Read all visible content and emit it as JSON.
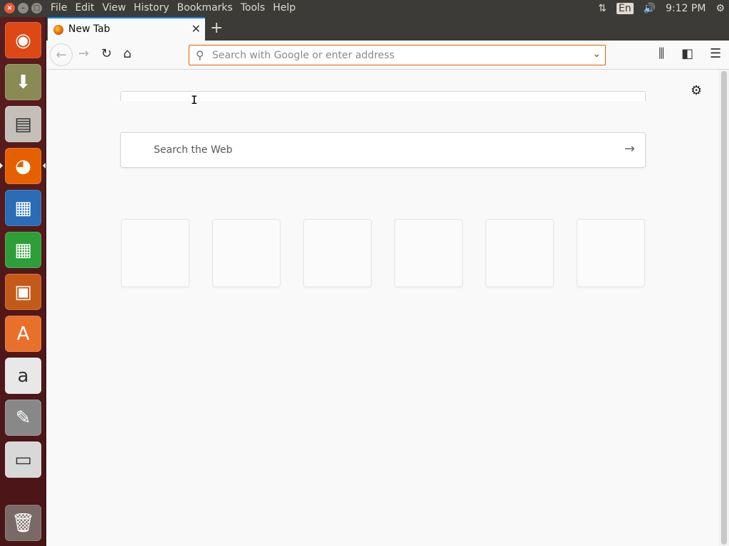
{
  "top_panel": {
    "menus": [
      "File",
      "Edit",
      "View",
      "History",
      "Bookmarks",
      "Tools",
      "Help"
    ],
    "language": "En",
    "clock": "9:12 PM",
    "icons": [
      "network-icon",
      "volume-icon",
      "system-gear-icon"
    ]
  },
  "launcher": {
    "items": [
      {
        "name": "ubuntu-dash-icon",
        "symbol": "◉",
        "bg": "#dd4814"
      },
      {
        "name": "software-updater-icon",
        "symbol": "⬇",
        "bg": "#8a8a55"
      },
      {
        "name": "file-manager-icon",
        "symbol": "▤",
        "bg": "#c4c0b8"
      },
      {
        "name": "firefox-icon",
        "symbol": "◕",
        "bg": "#e66000"
      },
      {
        "name": "libreoffice-writer-icon",
        "symbol": "▦",
        "bg": "#2a6cb5"
      },
      {
        "name": "libreoffice-calc-icon",
        "symbol": "▦",
        "bg": "#2e9e3a"
      },
      {
        "name": "libreoffice-impress-icon",
        "symbol": "▣",
        "bg": "#c45a1a"
      },
      {
        "name": "ubuntu-software-icon",
        "symbol": "A",
        "bg": "#e8702a"
      },
      {
        "name": "amazon-icon",
        "symbol": "a",
        "bg": "#e8e8e8"
      },
      {
        "name": "system-settings-icon",
        "symbol": "✎",
        "bg": "#888888"
      },
      {
        "name": "disk-icon",
        "symbol": "▭",
        "bg": "#d8d8d8"
      },
      {
        "name": "trash-icon",
        "symbol": "🗑",
        "bg": "#7a6a66"
      }
    ]
  },
  "browser": {
    "tab_title": "New Tab",
    "new_tab_symbol": "+",
    "url_placeholder": "Search with Google or enter address",
    "web_search_placeholder": "Search the Web",
    "top_sites_count": 6
  },
  "colors": {
    "accent": "#0a84ff",
    "urlbar_focus": "#e66000",
    "panel_bg": "#3c3b37",
    "launcher_bg": "#5a1d1f"
  }
}
